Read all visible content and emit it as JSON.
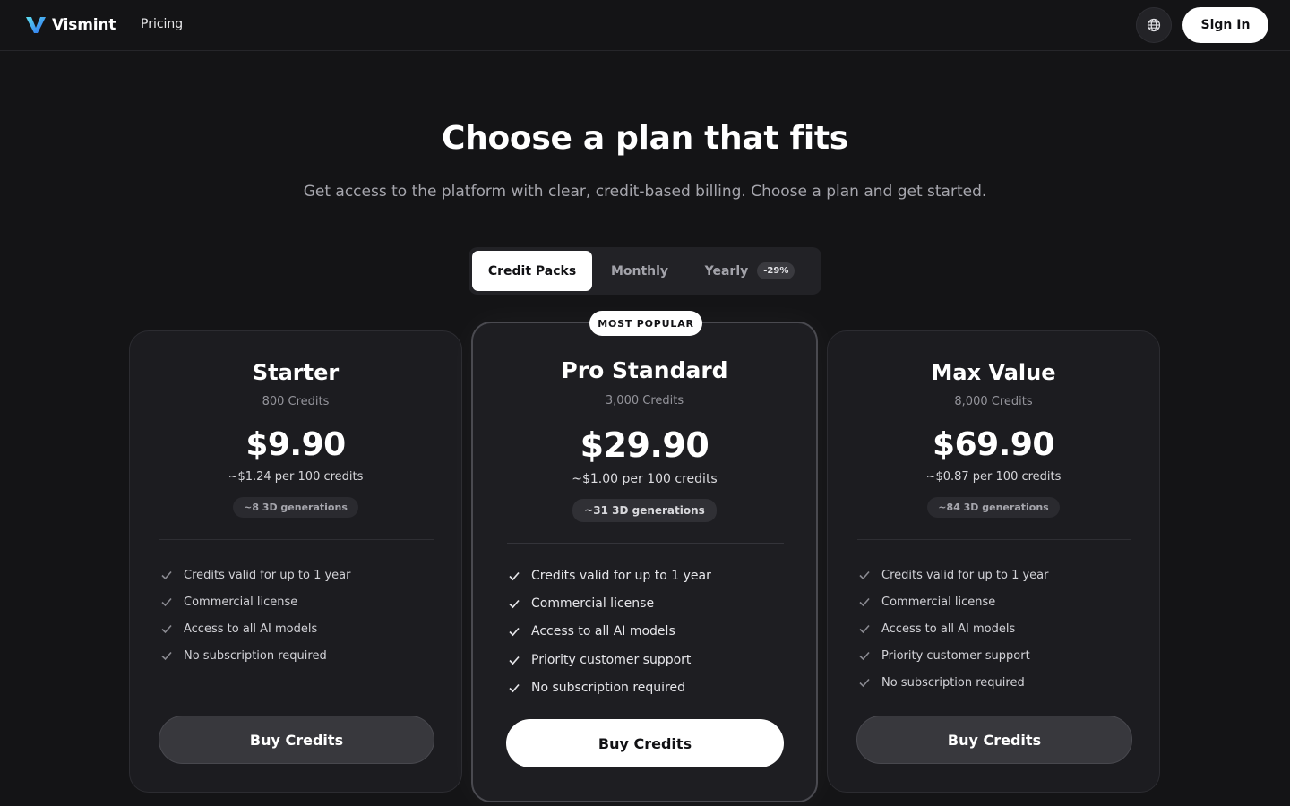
{
  "header": {
    "brand": "Vismint",
    "nav_pricing": "Pricing",
    "sign_in": "Sign In"
  },
  "hero": {
    "title": "Choose a plan that fits",
    "subtitle": "Get access to the platform with clear, credit-based billing. Choose a plan and get started."
  },
  "billing_toggle": {
    "options": [
      "Credit Packs",
      "Monthly",
      "Yearly"
    ],
    "selected": "Credit Packs",
    "yearly_discount": "-29%"
  },
  "plans": [
    {
      "name": "Starter",
      "credits": "800 Credits",
      "price": "$9.90",
      "per_100": "~$1.24 per 100 credits",
      "generations": "~8 3D generations",
      "features": [
        "Credits valid for up to 1 year",
        "Commercial license",
        "Access to all AI models",
        "No subscription required"
      ],
      "button": "Buy Credits"
    },
    {
      "name": "Pro Standard",
      "badge": "MOST POPULAR",
      "credits": "3,000 Credits",
      "price": "$29.90",
      "per_100": "~$1.00 per 100 credits",
      "generations": "~31 3D generations",
      "features": [
        "Credits valid for up to 1 year",
        "Commercial license",
        "Access to all AI models",
        "Priority customer support",
        "No subscription required"
      ],
      "button": "Buy Credits"
    },
    {
      "name": "Max Value",
      "credits": "8,000 Credits",
      "price": "$69.90",
      "per_100": "~$0.87 per 100 credits",
      "generations": "~84 3D generations",
      "features": [
        "Credits valid for up to 1 year",
        "Commercial license",
        "Access to all AI models",
        "Priority customer support",
        "No subscription required"
      ],
      "button": "Buy Credits"
    }
  ],
  "colors": {
    "background": "#141416",
    "card": "#1c1c20",
    "logo_gradient_start": "#4fd1e8",
    "logo_gradient_end": "#2b6cf0"
  },
  "icons": {
    "logo": "v-logo-icon",
    "language": "globe-icon",
    "feature": "check-icon"
  }
}
